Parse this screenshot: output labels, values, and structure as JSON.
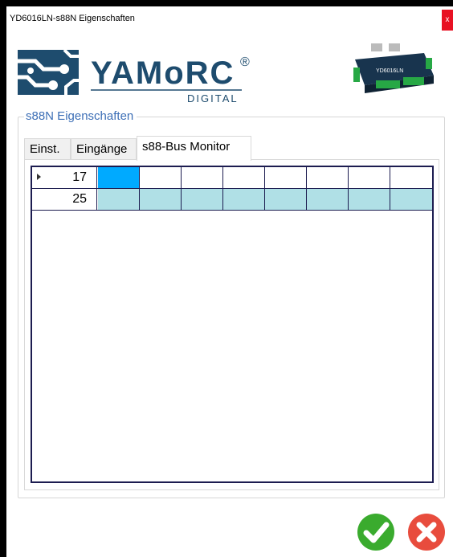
{
  "window": {
    "title": "YD6016LN-s88N Eigenschaften",
    "close_glyph": "x"
  },
  "brand": {
    "name": "YAMoRC",
    "registered": "®",
    "sub": "DIGITAL",
    "accent": "#1e4c6e",
    "device_label": "YD6016LN"
  },
  "group": {
    "legend": "s88N Eigenschaften"
  },
  "tabs": [
    {
      "label": "Einst.",
      "active": false
    },
    {
      "label": "Eingänge",
      "active": false
    },
    {
      "label": "s88-Bus Monitor",
      "active": true
    }
  ],
  "monitor": {
    "rows": [
      {
        "label": "17",
        "current": true,
        "cells": [
          "selected",
          "off",
          "off",
          "off",
          "off",
          "off",
          "off",
          "off"
        ]
      },
      {
        "label": "25",
        "current": false,
        "cells": [
          "on",
          "on",
          "on",
          "on",
          "on",
          "on",
          "on",
          "on"
        ]
      }
    ],
    "colors": {
      "selected": "#00aaff",
      "on": "#b0e0e6",
      "off": "#ffffff",
      "grid_line": "#1c1c50"
    }
  },
  "buttons": {
    "ok_icon": "check-icon",
    "cancel_icon": "cross-icon",
    "ok_color": "#3aab2e",
    "cancel_color": "#e84c3d"
  }
}
